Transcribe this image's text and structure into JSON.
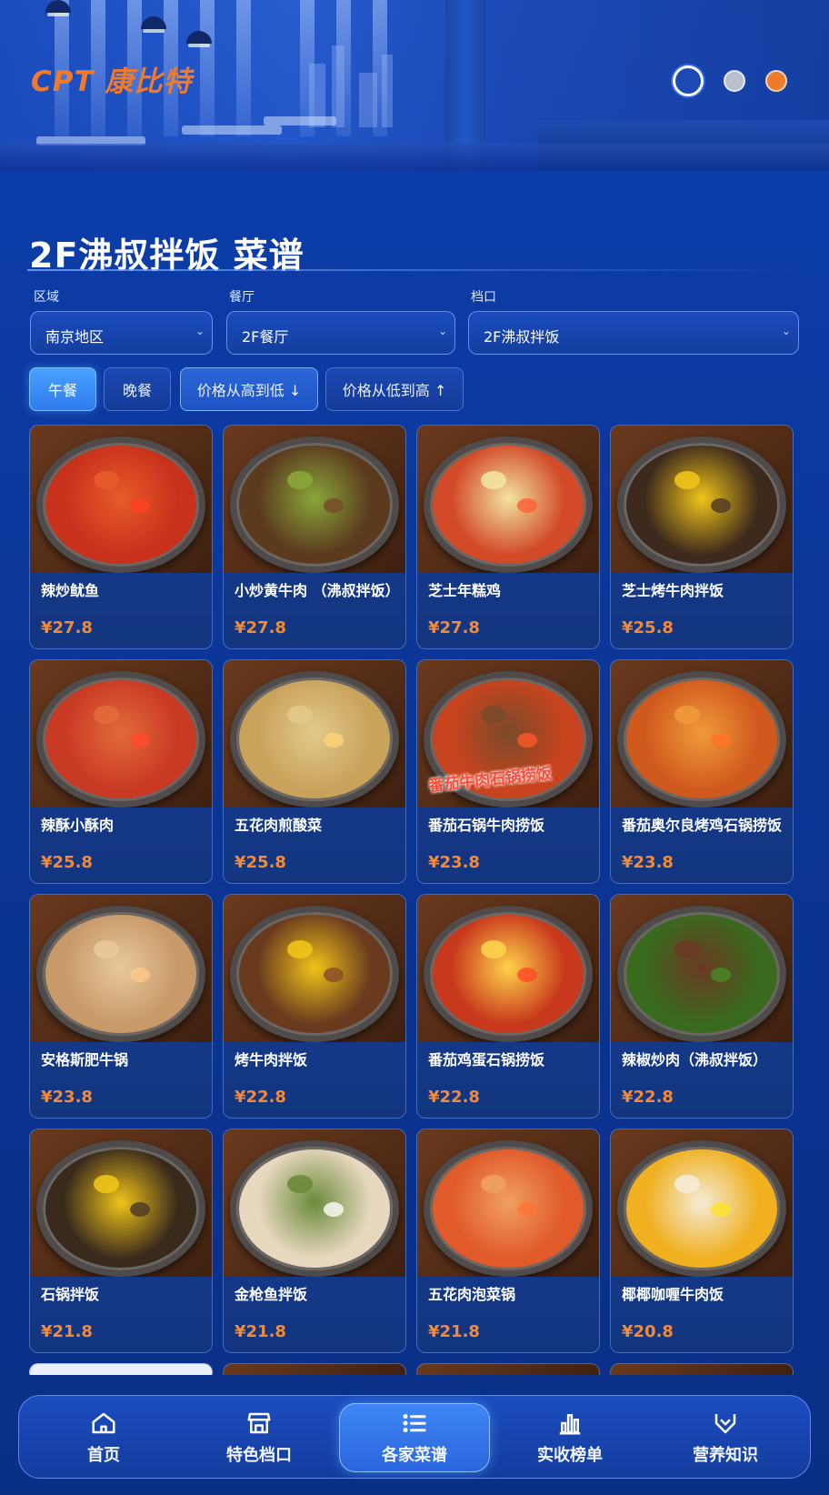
{
  "brand": {
    "logo_text": "CPT 康比特"
  },
  "page": {
    "title": "2F沸叔拌饭 菜谱"
  },
  "filters": {
    "region_label": "区域",
    "region_value": "南京地区",
    "restaurant_label": "餐厅",
    "restaurant_value": "2F餐厅",
    "stall_label": "档口",
    "stall_value": "2F沸叔拌饭"
  },
  "meal_tabs": {
    "lunch": "午餐",
    "dinner": "晚餐"
  },
  "sort": {
    "high_to_low": "价格从高到低 ↓",
    "low_to_high": "价格从低到高 ↑"
  },
  "dishes": [
    {
      "name": "辣炒鱿鱼",
      "price": "¥27.8"
    },
    {
      "name": "小炒黄牛肉 （沸叔拌饭）",
      "price": "¥27.8"
    },
    {
      "name": "芝士年糕鸡",
      "price": "¥27.8"
    },
    {
      "name": "芝士烤牛肉拌饭",
      "price": "¥25.8"
    },
    {
      "name": "辣酥小酥肉",
      "price": "¥25.8"
    },
    {
      "name": "五花肉煎酸菜",
      "price": "¥25.8"
    },
    {
      "name": "番茄石锅牛肉捞饭",
      "price": "¥23.8"
    },
    {
      "name": "番茄奥尔良烤鸡石锅捞饭",
      "price": "¥23.8"
    },
    {
      "name": "安格斯肥牛锅",
      "price": "¥23.8"
    },
    {
      "name": "烤牛肉拌饭",
      "price": "¥22.8"
    },
    {
      "name": "番茄鸡蛋石锅捞饭",
      "price": "¥22.8"
    },
    {
      "name": "辣椒炒肉（沸叔拌饭）",
      "price": "¥22.8"
    },
    {
      "name": "石锅拌饭",
      "price": "¥21.8"
    },
    {
      "name": "金枪鱼拌饭",
      "price": "¥21.8"
    },
    {
      "name": "五花肉泡菜锅",
      "price": "¥21.8"
    },
    {
      "name": "椰椰咖喱牛肉饭",
      "price": "¥20.8"
    }
  ],
  "photo_labels": {
    "dish_7_overlay": "番茄牛肉石锅捞饭"
  },
  "nav": {
    "home": "首页",
    "featured": "特色档口",
    "menus": "各家菜谱",
    "ranking": "实收榜单",
    "nutrition": "营养知识"
  },
  "colors": {
    "accent": "#f28a3a",
    "primary": "#0d3fb0",
    "active": "#3f86f5"
  }
}
